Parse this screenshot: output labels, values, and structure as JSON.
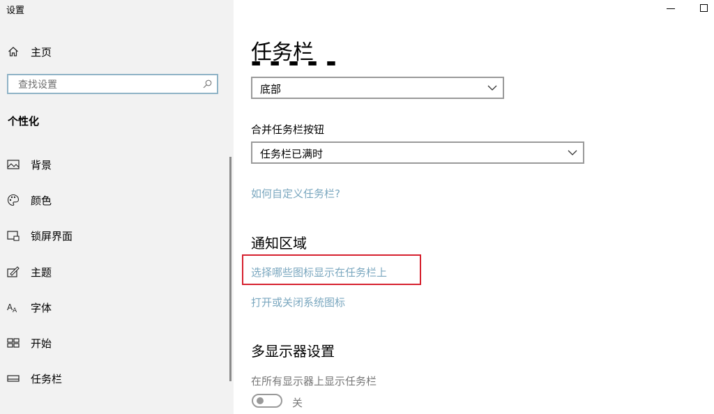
{
  "window": {
    "title": "设置"
  },
  "sidebar": {
    "home_label": "主页",
    "search_placeholder": "查找设置",
    "section_heading": "个性化",
    "items": [
      {
        "label": "背景",
        "icon": "picture-icon"
      },
      {
        "label": "颜色",
        "icon": "palette-icon"
      },
      {
        "label": "锁屏界面",
        "icon": "lock-screen-icon"
      },
      {
        "label": "主题",
        "icon": "theme-icon"
      },
      {
        "label": "字体",
        "icon": "font-icon"
      },
      {
        "label": "开始",
        "icon": "start-icon"
      },
      {
        "label": "任务栏",
        "icon": "taskbar-icon"
      }
    ]
  },
  "main": {
    "title": "任务栏",
    "position_dropdown_value": "底部",
    "combine_label": "合并任务栏按钮",
    "combine_dropdown_value": "任务栏已满时",
    "customize_link": "如何自定义任务栏?",
    "notification_heading": "通知区域",
    "choose_icons_link": "选择哪些图标显示在任务栏上",
    "system_icons_link": "打开或关闭系统图标",
    "multi_display_heading": "多显示器设置",
    "show_on_all_label": "在所有显示器上显示任务栏",
    "toggle_state": "关"
  },
  "colors": {
    "sidebar_bg": "#f2f2f2",
    "link": "#7aa7bf",
    "highlight": "#d6202e"
  }
}
